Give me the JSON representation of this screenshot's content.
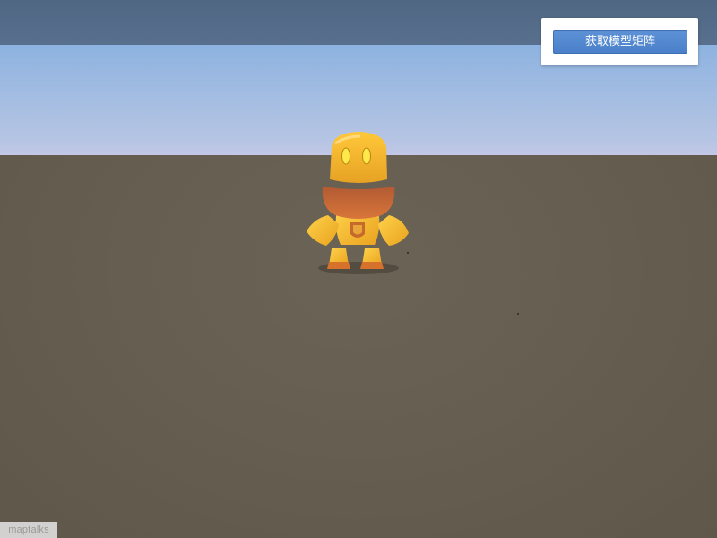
{
  "toolbar": {
    "get_model_matrix_label": "获取模型矩阵"
  },
  "branding": {
    "logo_text": "maptalks"
  },
  "scene": {
    "sky_color": "#8db3e0",
    "ground_color": "#665e50",
    "model_colors": {
      "body": "#f4b62c",
      "dark": "#c8642e",
      "eyes": "#ffe84a"
    }
  },
  "colors": {
    "button_bg": "#4a80c9",
    "panel_bg": "#ffffff"
  }
}
